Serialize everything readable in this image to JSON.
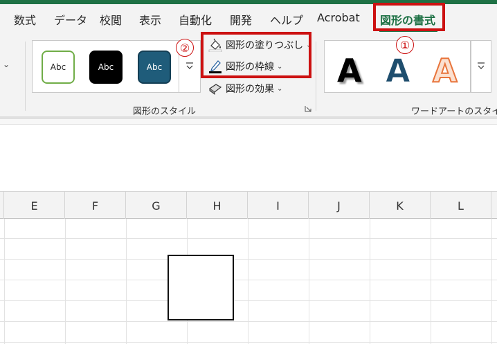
{
  "ribbon_tabs": [
    {
      "label": "数式"
    },
    {
      "label": "データ"
    },
    {
      "label": "校閲"
    },
    {
      "label": "表示"
    },
    {
      "label": "自動化"
    },
    {
      "label": "開発"
    },
    {
      "label": "ヘルプ"
    },
    {
      "label": "Acrobat"
    },
    {
      "label": "図形の書式",
      "active": true
    }
  ],
  "shape_styles": {
    "swatches": [
      {
        "label": "Abc",
        "fill": "#ffffff",
        "border": "#70ad47",
        "text_color": "#222222"
      },
      {
        "label": "Abc",
        "fill": "#000000",
        "border": "#000000",
        "text_color": "#ffffff"
      },
      {
        "label": "Abc",
        "fill": "#1f5c7a",
        "border": "#133e54",
        "text_color": "#ffffff"
      }
    ],
    "fill_label": "図形の塗りつぶし",
    "outline_label": "図形の枠線",
    "effects_label": "図形の効果",
    "group_label": "図形のスタイル"
  },
  "wordart": {
    "letters": [
      {
        "char": "A",
        "style": "black-shadow"
      },
      {
        "char": "A",
        "style": "blue-outline"
      },
      {
        "char": "A",
        "style": "orange-outline"
      }
    ],
    "group_label": "ワードアートのスタイル"
  },
  "annotations": {
    "badge_1": "①",
    "badge_2": "②",
    "color": "#cc1111"
  },
  "columns": [
    "E",
    "F",
    "G",
    "H",
    "I",
    "J",
    "K",
    "L"
  ],
  "icons": {
    "collapse": "chevron-down-icon",
    "more": "gallery-more-icon",
    "fill": "paint-bucket-icon",
    "outline": "pen-outline-icon",
    "effects": "shape-effects-icon",
    "launcher": "dialog-launcher-icon"
  },
  "theme": {
    "accent": "#1e7145"
  }
}
